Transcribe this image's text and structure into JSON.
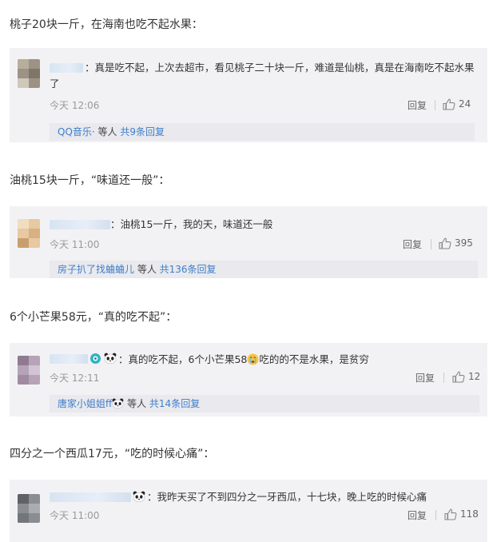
{
  "sections": [
    {
      "heading": "桃子20块一斤，在海南也吃不起水果：",
      "comment_text": "：真是吃不起，上次去超市，看见桃子二十块一斤，难道是仙桃，真是在海南吃不起水果",
      "comment_text_wrap": "了",
      "time": "今天 12:06",
      "reply_label": "回复",
      "likes": "24",
      "sub_user": "QQ音乐·",
      "sub_mid": " 等人 ",
      "sub_count": "共9条回复"
    },
    {
      "heading": "油桃15块一斤，“味道还一般”：",
      "comment_text": "：油桃15一斤，我的天，味道还一般",
      "time": "今天 11:00",
      "reply_label": "回复",
      "likes": "395",
      "sub_user": "房子扒了找蛐蛐儿",
      "sub_mid": " 等人 ",
      "sub_count": "共136条回复"
    },
    {
      "heading": "6个小芒果58元，“真的吃不起”：",
      "comment_text_a": "：真的吃不起，6个小芒果58",
      "comment_text_b": "吃的的不是水果，是贫穷",
      "time": "今天 12:11",
      "reply_label": "回复",
      "likes": "12",
      "sub_user": "唐家小姐姐ff",
      "sub_mid": " 等人 ",
      "sub_count": "共14条回复"
    },
    {
      "heading": "四分之一个西瓜17元，“吃的时候心痛”：",
      "comment_text": "：我昨天买了不到四分之一牙西瓜，十七块，晚上吃的时候心痛",
      "time": "今天 11:00",
      "reply_label": "回复",
      "likes": "118"
    }
  ],
  "icons": {
    "like": "thumbs-up-icon",
    "panda": "panda-emoji-icon",
    "crying": "crying-emoji-icon",
    "badge": "vip-badge-icon"
  },
  "colors": {
    "link": "#3f7fc8",
    "card_bg": "#f2f2f5",
    "sub_bg": "#e9e9ee"
  }
}
